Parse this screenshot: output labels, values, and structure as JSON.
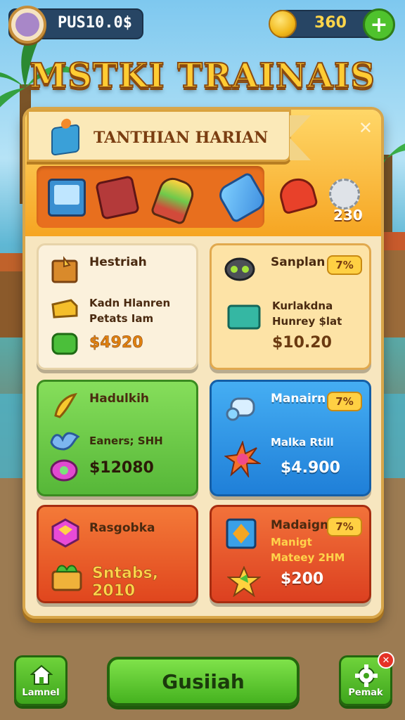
{
  "header": {
    "player_name": "PUS10.0$",
    "coin_amount": "360",
    "game_title": "MSTKI TRAINAIS"
  },
  "panel": {
    "section_title": "TANTHIAN HARIAN",
    "close_glyph": "✕",
    "tray_count": "230"
  },
  "cards": [
    {
      "title": "Hestriah",
      "desc1": "Kadn Hlanren",
      "desc2": "Petats Iam",
      "price": "$4920",
      "icons": [
        "wood-crate-icon",
        "gold-bar-icon",
        "green-gem-icon"
      ]
    },
    {
      "title": "Sanplan",
      "badge": "7%",
      "desc1": "Kurlakdna",
      "desc2": "Hunrey $lat",
      "price": "$10.20",
      "icons": [
        "goggles-icon",
        "teal-block-icon"
      ]
    },
    {
      "title": "Hadulkih",
      "desc1": "Eaners; SHH",
      "price": "$12080",
      "icons": [
        "banana-icon",
        "crab-icon",
        "potion-icon"
      ]
    },
    {
      "title": "Manairn",
      "badge": "7%",
      "desc1": "Malka Rtill",
      "price": "$4.900",
      "icons": [
        "scroll-icon",
        "spiked-flower-icon"
      ]
    },
    {
      "title": "Rasgobka",
      "desc1": "Sntabs, 2010",
      "icons": [
        "pink-gem-icon",
        "green-gift-box-icon"
      ]
    },
    {
      "title": "Madaign",
      "badge": "7%",
      "desc1": "Manigt",
      "desc2": "Mateey 2HM",
      "price": "$200",
      "icons": [
        "framed-gem-icon",
        "gold-star-icon"
      ]
    }
  ],
  "footer": {
    "home_label": "Lamnel",
    "main_label": "Gusiiah",
    "settings_label": "Pemak",
    "notification_glyph": "✕"
  },
  "colors": {
    "panel_bg": "#f7e6bf",
    "header_orange": "#f6a522",
    "button_green": "#45b21f",
    "card_blue": "#1f7fd8",
    "card_red": "#e0461e"
  }
}
